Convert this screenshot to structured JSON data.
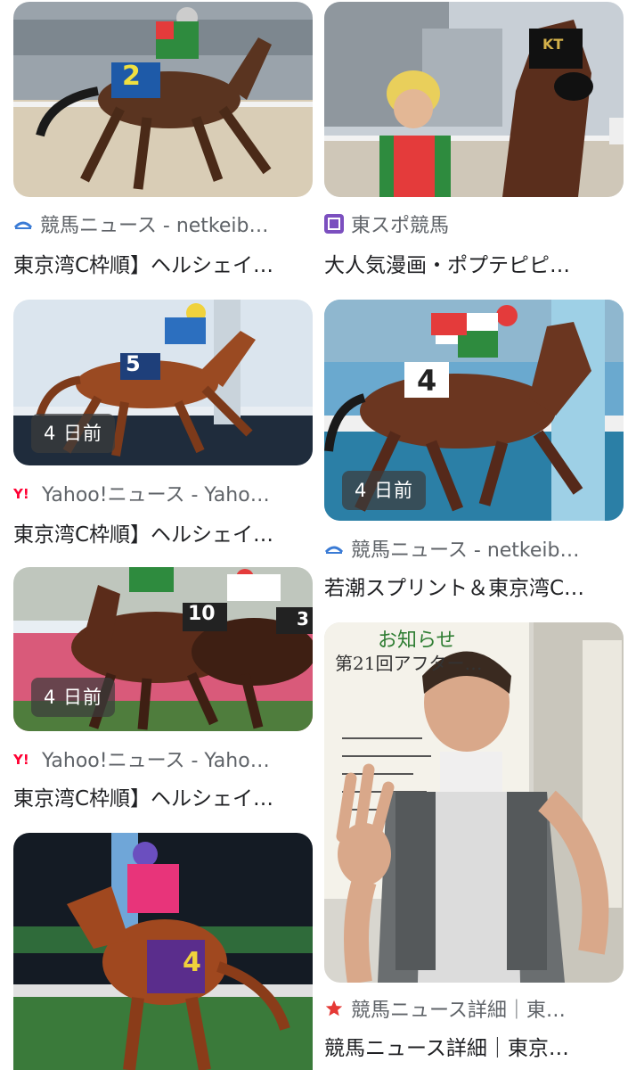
{
  "colors": {
    "source_text": "#5f6368",
    "title_text": "#202124",
    "yahoo_red": "#ff0033",
    "tosupo_purple": "#7b4fbf",
    "star_red": "#e53935"
  },
  "results": [
    {
      "source": "競馬ニュース - netkeib…",
      "title": "東京湾C枠順】ヘルシェイ…",
      "source_icon": "netkeiba-icon",
      "age": ""
    },
    {
      "source": "東スポ競馬",
      "title": "大人気漫画・ポプテピピ…",
      "source_icon": "tosupo-icon",
      "age": ""
    },
    {
      "source": "Yahoo!ニュース - Yaho…",
      "title": "東京湾C枠順】ヘルシェイ…",
      "source_icon": "yahoo-icon",
      "age": "4 日前"
    },
    {
      "source": "競馬ニュース - netkeib…",
      "title": "若潮スプリント＆東京湾C…",
      "source_icon": "netkeiba-icon",
      "age": "4 日前"
    },
    {
      "source": "Yahoo!ニュース - Yaho…",
      "title": "東京湾C枠順】ヘルシェイ…",
      "source_icon": "yahoo-icon",
      "age": "4 日前"
    },
    {
      "source": "競馬ニュース詳細｜東…",
      "title": "競馬ニュース詳細｜東京…",
      "source_icon": "star-icon",
      "age": ""
    },
    {
      "source": "",
      "title": "",
      "source_icon": "",
      "age": ""
    }
  ],
  "images": {
    "r0": {
      "number": "2"
    },
    "r1": {
      "mask_letters": "KT"
    },
    "r2": {
      "number": "5"
    },
    "r3": {
      "number": "4"
    },
    "r4": {
      "number": "10",
      "number2": "3"
    },
    "r5": {
      "notice_heading": "お知らせ",
      "notice_title": "第21回アフター…"
    },
    "r6": {
      "number": "4"
    }
  }
}
